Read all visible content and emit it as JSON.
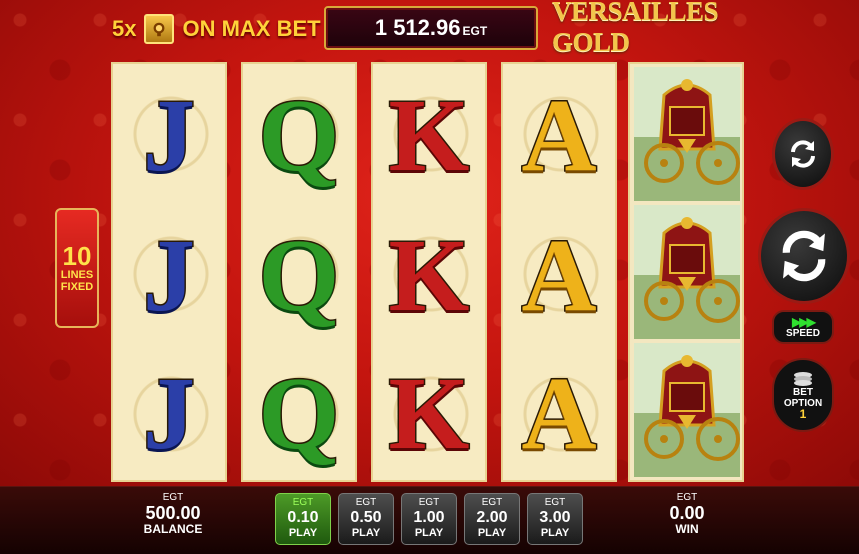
{
  "promo": {
    "multiplier": "5x",
    "text": "ON MAX BET",
    "icon": "scatter-symbol-icon"
  },
  "credit": {
    "value": "1 512.96",
    "currency": "EGT"
  },
  "logo": {
    "text": "VERSAILLES GOLD"
  },
  "lines": {
    "count": "10",
    "label": "LINES FIXED"
  },
  "reels": [
    [
      "J",
      "J",
      "J"
    ],
    [
      "Q",
      "Q",
      "Q"
    ],
    [
      "K",
      "K",
      "K"
    ],
    [
      "A",
      "A",
      "A"
    ],
    [
      "carriage",
      "carriage",
      "carriage"
    ]
  ],
  "speed": {
    "label": "SPEED"
  },
  "bet_option": {
    "label": "BET OPTION",
    "value": "1"
  },
  "balance": {
    "currency": "EGT",
    "value": "500.00",
    "label": "BALANCE"
  },
  "bets": [
    {
      "currency": "EGT",
      "value": "0.10",
      "label": "PLAY"
    },
    {
      "currency": "EGT",
      "value": "0.50",
      "label": "PLAY"
    },
    {
      "currency": "EGT",
      "value": "1.00",
      "label": "PLAY"
    },
    {
      "currency": "EGT",
      "value": "2.00",
      "label": "PLAY"
    },
    {
      "currency": "EGT",
      "value": "3.00",
      "label": "PLAY"
    }
  ],
  "selected_bet": 0,
  "win": {
    "currency": "EGT",
    "value": "0.00",
    "label": "WIN"
  },
  "colors": {
    "selected_bet": "#4d9a27",
    "accent_gold": "#ffd23a",
    "background_red": "#c4150f"
  }
}
